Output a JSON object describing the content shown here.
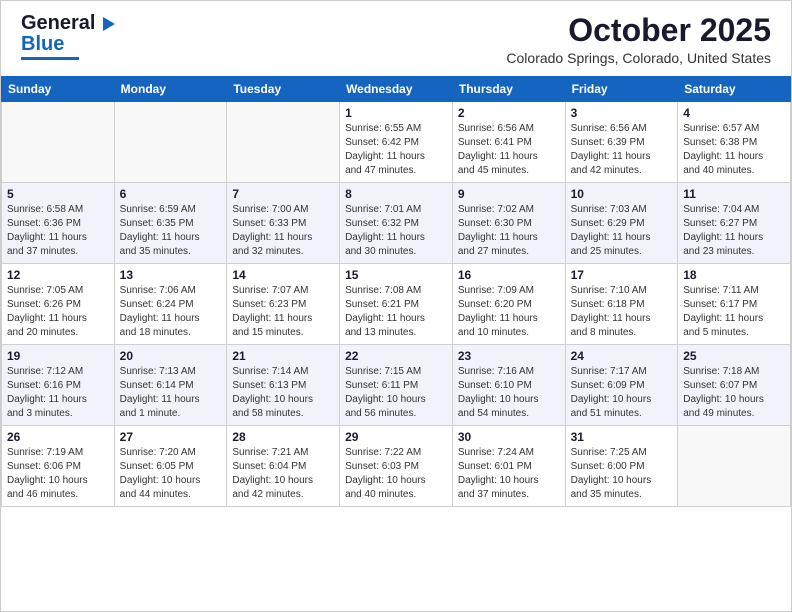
{
  "header": {
    "logo_line1": "General",
    "logo_line2": "Blue",
    "month_title": "October 2025",
    "location": "Colorado Springs, Colorado, United States"
  },
  "weekdays": [
    "Sunday",
    "Monday",
    "Tuesday",
    "Wednesday",
    "Thursday",
    "Friday",
    "Saturday"
  ],
  "weeks": [
    [
      {
        "day": "",
        "info": ""
      },
      {
        "day": "",
        "info": ""
      },
      {
        "day": "",
        "info": ""
      },
      {
        "day": "1",
        "info": "Sunrise: 6:55 AM\nSunset: 6:42 PM\nDaylight: 11 hours\nand 47 minutes."
      },
      {
        "day": "2",
        "info": "Sunrise: 6:56 AM\nSunset: 6:41 PM\nDaylight: 11 hours\nand 45 minutes."
      },
      {
        "day": "3",
        "info": "Sunrise: 6:56 AM\nSunset: 6:39 PM\nDaylight: 11 hours\nand 42 minutes."
      },
      {
        "day": "4",
        "info": "Sunrise: 6:57 AM\nSunset: 6:38 PM\nDaylight: 11 hours\nand 40 minutes."
      }
    ],
    [
      {
        "day": "5",
        "info": "Sunrise: 6:58 AM\nSunset: 6:36 PM\nDaylight: 11 hours\nand 37 minutes."
      },
      {
        "day": "6",
        "info": "Sunrise: 6:59 AM\nSunset: 6:35 PM\nDaylight: 11 hours\nand 35 minutes."
      },
      {
        "day": "7",
        "info": "Sunrise: 7:00 AM\nSunset: 6:33 PM\nDaylight: 11 hours\nand 32 minutes."
      },
      {
        "day": "8",
        "info": "Sunrise: 7:01 AM\nSunset: 6:32 PM\nDaylight: 11 hours\nand 30 minutes."
      },
      {
        "day": "9",
        "info": "Sunrise: 7:02 AM\nSunset: 6:30 PM\nDaylight: 11 hours\nand 27 minutes."
      },
      {
        "day": "10",
        "info": "Sunrise: 7:03 AM\nSunset: 6:29 PM\nDaylight: 11 hours\nand 25 minutes."
      },
      {
        "day": "11",
        "info": "Sunrise: 7:04 AM\nSunset: 6:27 PM\nDaylight: 11 hours\nand 23 minutes."
      }
    ],
    [
      {
        "day": "12",
        "info": "Sunrise: 7:05 AM\nSunset: 6:26 PM\nDaylight: 11 hours\nand 20 minutes."
      },
      {
        "day": "13",
        "info": "Sunrise: 7:06 AM\nSunset: 6:24 PM\nDaylight: 11 hours\nand 18 minutes."
      },
      {
        "day": "14",
        "info": "Sunrise: 7:07 AM\nSunset: 6:23 PM\nDaylight: 11 hours\nand 15 minutes."
      },
      {
        "day": "15",
        "info": "Sunrise: 7:08 AM\nSunset: 6:21 PM\nDaylight: 11 hours\nand 13 minutes."
      },
      {
        "day": "16",
        "info": "Sunrise: 7:09 AM\nSunset: 6:20 PM\nDaylight: 11 hours\nand 10 minutes."
      },
      {
        "day": "17",
        "info": "Sunrise: 7:10 AM\nSunset: 6:18 PM\nDaylight: 11 hours\nand 8 minutes."
      },
      {
        "day": "18",
        "info": "Sunrise: 7:11 AM\nSunset: 6:17 PM\nDaylight: 11 hours\nand 5 minutes."
      }
    ],
    [
      {
        "day": "19",
        "info": "Sunrise: 7:12 AM\nSunset: 6:16 PM\nDaylight: 11 hours\nand 3 minutes."
      },
      {
        "day": "20",
        "info": "Sunrise: 7:13 AM\nSunset: 6:14 PM\nDaylight: 11 hours\nand 1 minute."
      },
      {
        "day": "21",
        "info": "Sunrise: 7:14 AM\nSunset: 6:13 PM\nDaylight: 10 hours\nand 58 minutes."
      },
      {
        "day": "22",
        "info": "Sunrise: 7:15 AM\nSunset: 6:11 PM\nDaylight: 10 hours\nand 56 minutes."
      },
      {
        "day": "23",
        "info": "Sunrise: 7:16 AM\nSunset: 6:10 PM\nDaylight: 10 hours\nand 54 minutes."
      },
      {
        "day": "24",
        "info": "Sunrise: 7:17 AM\nSunset: 6:09 PM\nDaylight: 10 hours\nand 51 minutes."
      },
      {
        "day": "25",
        "info": "Sunrise: 7:18 AM\nSunset: 6:07 PM\nDaylight: 10 hours\nand 49 minutes."
      }
    ],
    [
      {
        "day": "26",
        "info": "Sunrise: 7:19 AM\nSunset: 6:06 PM\nDaylight: 10 hours\nand 46 minutes."
      },
      {
        "day": "27",
        "info": "Sunrise: 7:20 AM\nSunset: 6:05 PM\nDaylight: 10 hours\nand 44 minutes."
      },
      {
        "day": "28",
        "info": "Sunrise: 7:21 AM\nSunset: 6:04 PM\nDaylight: 10 hours\nand 42 minutes."
      },
      {
        "day": "29",
        "info": "Sunrise: 7:22 AM\nSunset: 6:03 PM\nDaylight: 10 hours\nand 40 minutes."
      },
      {
        "day": "30",
        "info": "Sunrise: 7:24 AM\nSunset: 6:01 PM\nDaylight: 10 hours\nand 37 minutes."
      },
      {
        "day": "31",
        "info": "Sunrise: 7:25 AM\nSunset: 6:00 PM\nDaylight: 10 hours\nand 35 minutes."
      },
      {
        "day": "",
        "info": ""
      }
    ]
  ]
}
